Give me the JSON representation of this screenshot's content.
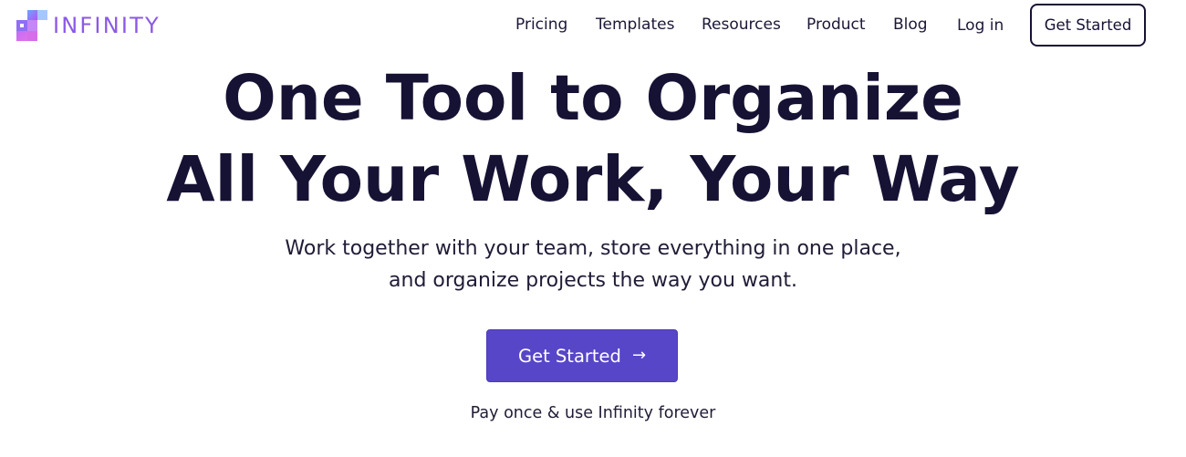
{
  "header": {
    "logo_text": "INFINITY",
    "nav": [
      {
        "label": "Pricing"
      },
      {
        "label": "Templates"
      },
      {
        "label": "Resources"
      },
      {
        "label": "Product"
      },
      {
        "label": "Blog"
      },
      {
        "label": "Log in"
      }
    ],
    "cta_label": "Get Started"
  },
  "hero": {
    "title_line_1": "One Tool to Organize",
    "title_line_2": "All Your Work, Your Way",
    "subtitle_line_1": "Work together with your team, store everything in one place,",
    "subtitle_line_2": "and organize projects the way you want.",
    "cta_label": "Get Started",
    "cta_icon": "arrow-right-icon",
    "note": "Pay once & use Infinity forever"
  },
  "colors": {
    "brand": "#8c59e6",
    "primary_button": "#5746c7",
    "text": "#161234"
  }
}
